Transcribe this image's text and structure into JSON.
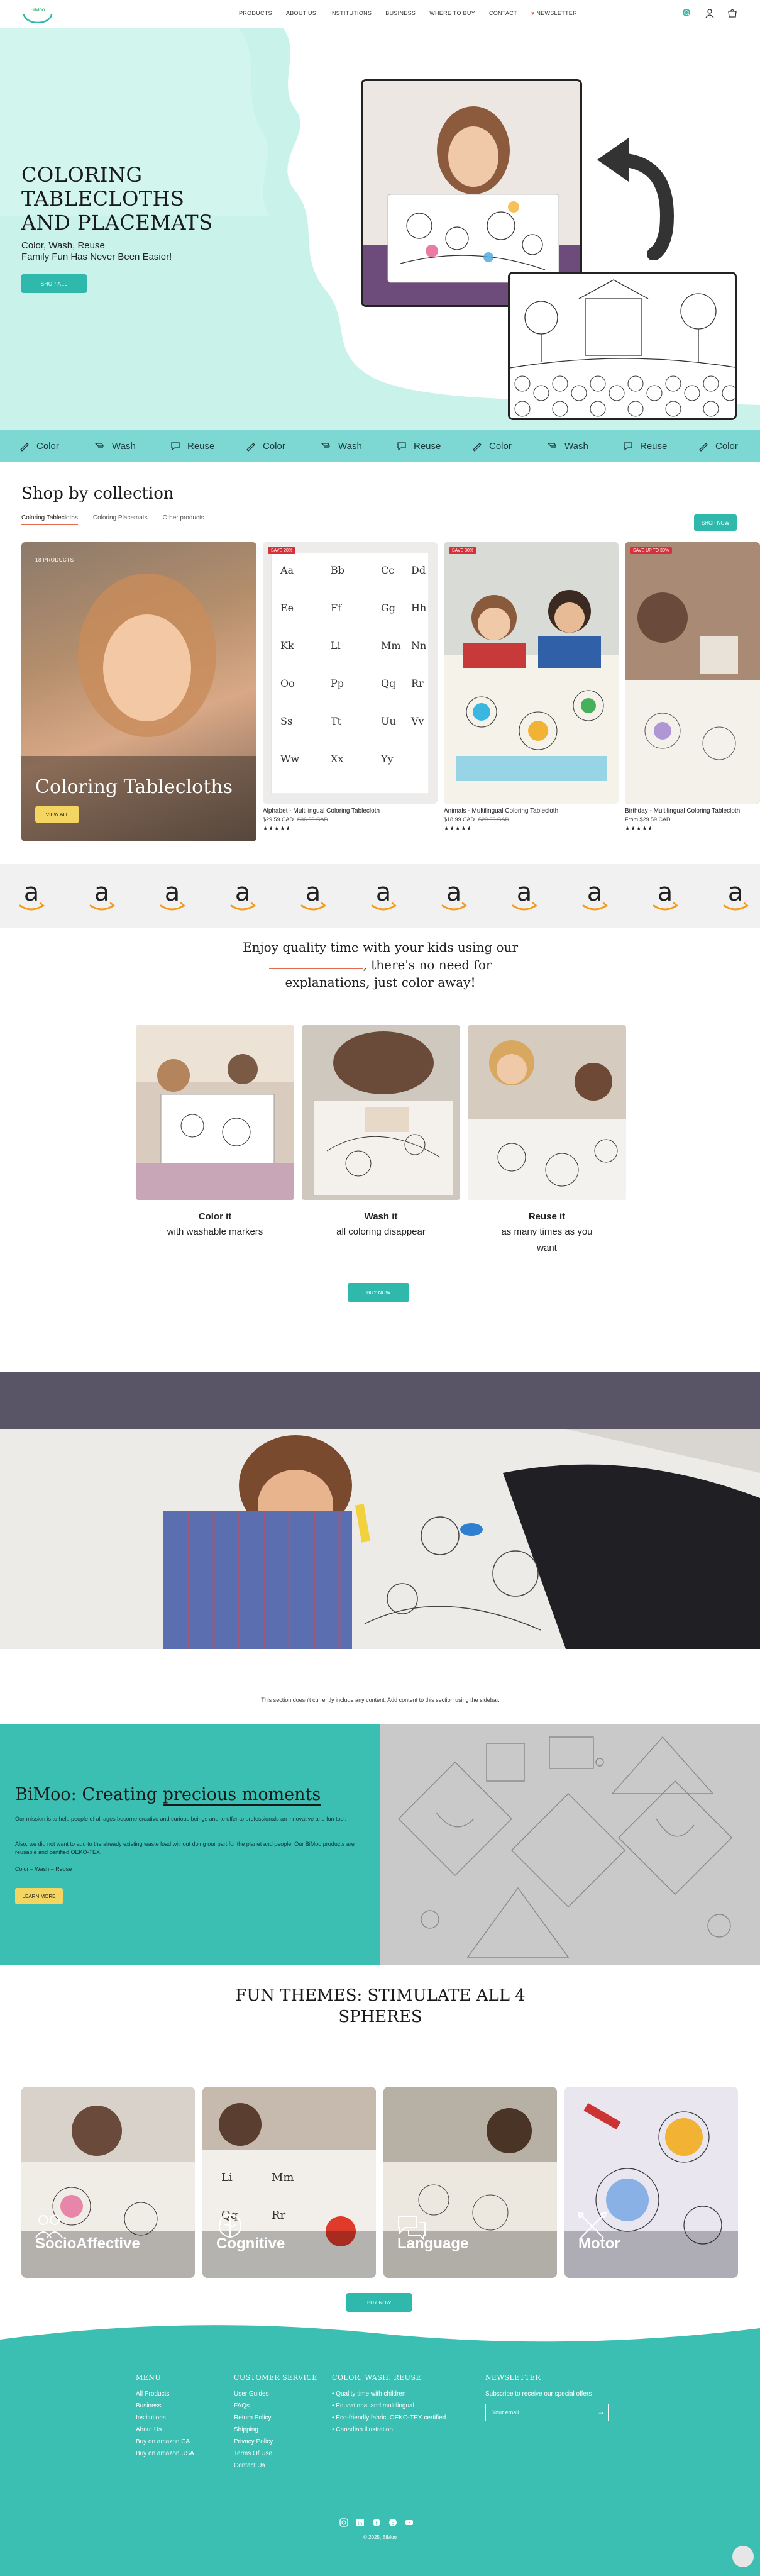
{
  "header": {
    "logo_text": "BiMoo",
    "nav": [
      "PRODUCTS",
      "ABOUT US",
      "INSTITUTIONS",
      "BUSINESS",
      "WHERE TO BUY",
      "CONTACT",
      "NEWSLETTER"
    ],
    "icons": [
      "search-icon",
      "user-icon",
      "cart-icon"
    ]
  },
  "hero": {
    "title": "COLORING TABLECLOTHS AND PLACEMATS",
    "subtitle_1": "Color, Wash, Reuse",
    "subtitle_2": "Family Fun Has Never Been Easier!",
    "button": "SHOP ALL"
  },
  "marquee": [
    {
      "label": "Color",
      "icon": "crayon-icon"
    },
    {
      "label": "Wash",
      "icon": "wash-icon"
    },
    {
      "label": "Reuse",
      "icon": "reuse-icon"
    },
    {
      "label": "Color",
      "icon": "crayon-icon"
    },
    {
      "label": "Wash",
      "icon": "wash-icon"
    },
    {
      "label": "Reuse",
      "icon": "reuse-icon"
    },
    {
      "label": "Color",
      "icon": "crayon-icon"
    },
    {
      "label": "Wash",
      "icon": "wash-icon"
    },
    {
      "label": "Reuse",
      "icon": "reuse-icon"
    },
    {
      "label": "Color",
      "icon": "crayon-icon"
    }
  ],
  "collection": {
    "title": "Shop by collection",
    "tabs": [
      "Coloring Tablecloths",
      "Coloring Placemats",
      "Other products"
    ],
    "shop_now": "SHOP NOW",
    "feature": {
      "tag": "18 PRODUCTS",
      "title": "Coloring Tablecloths",
      "button": "VIEW ALL"
    },
    "products": [
      {
        "badge": "SAVE 20%",
        "name": "Alphabet - Multilingual Coloring Tablecloth",
        "price": "$29.59 CAD",
        "old": "$36.99 CAD",
        "stars": "★★★★★"
      },
      {
        "badge": "SAVE 30%",
        "name": "Animals - Multilingual Coloring Tablecloth",
        "price": "$18.99 CAD",
        "old": "$29.99 CAD",
        "stars": "★★★★★"
      },
      {
        "badge": "SAVE UP TO 30%",
        "name": "Birthday - Multilingual Coloring Tablecloth",
        "price": "From $29.59 CAD",
        "old": "",
        "stars": "★★★★★"
      }
    ]
  },
  "quality": {
    "line1": "Enjoy quality time with your kids using our",
    "line2": ", there's no need for",
    "line3": "explanations, just color away!",
    "cards": [
      {
        "title": "Color it",
        "text": "with washable markers"
      },
      {
        "title": "Wash it",
        "text": "all coloring disappear"
      },
      {
        "title": "Reuse it",
        "text": "as many times as you want"
      }
    ],
    "button": "BUY NOW"
  },
  "no_content": "This section doesn't currently include any content. Add content to this section using the sidebar.",
  "bimoo": {
    "title_a": "BiMoo: Creating ",
    "title_b": "precious moments",
    "p1": "Our mission is to help people of all ages become creative and curious beings and to offer to professionals an innovative and fun tool.",
    "p2": "Also, we did not want to add to the already existing waste load without doing our part for the planet and people. Our BiMoo products are reusable and certified OEKO-TEX.",
    "p3": "Color – Wash – Reuse",
    "button": "LEARN MORE"
  },
  "themes": {
    "title": "FUN THEMES: STIMULATE ALL 4 SPHERES",
    "items": [
      "SocioAffective",
      "Cognitive",
      "Language",
      "Motor"
    ],
    "button": "BUY NOW"
  },
  "footer": {
    "menu_title": "MENU",
    "menu": [
      "All Products",
      "Business",
      "Institutions",
      "About Us",
      "Buy on amazon CA",
      "Buy on amazon USA"
    ],
    "service_title": "CUSTOMER SERVICE",
    "service": [
      "User Guides",
      "FAQs",
      "Return Policy",
      "Shipping",
      "Privacy Policy",
      "Terms Of Use",
      "Contact Us"
    ],
    "cwr_title": "COLOR. WASH. REUSE",
    "cwr": [
      "• Quality time with children",
      "• Educational and multilingual",
      "• Eco-friendly fabric, OEKO-TEX certified",
      "• Canadian illustration"
    ],
    "newsletter_title": "NEWSLETTER",
    "newsletter_text": "Subscribe to receive our special offers",
    "email_placeholder": "Your email",
    "socials": [
      "instagram-icon",
      "linkedin-icon",
      "facebook-icon",
      "pinterest-icon",
      "youtube-icon"
    ],
    "copyright": "© 2025, BiMoo"
  },
  "colors": {
    "teal": "#2fb9ad",
    "mint": "#c9f2ea",
    "yellow": "#f5d562",
    "coral": "#e46a4e",
    "badge": "#d8303a"
  }
}
